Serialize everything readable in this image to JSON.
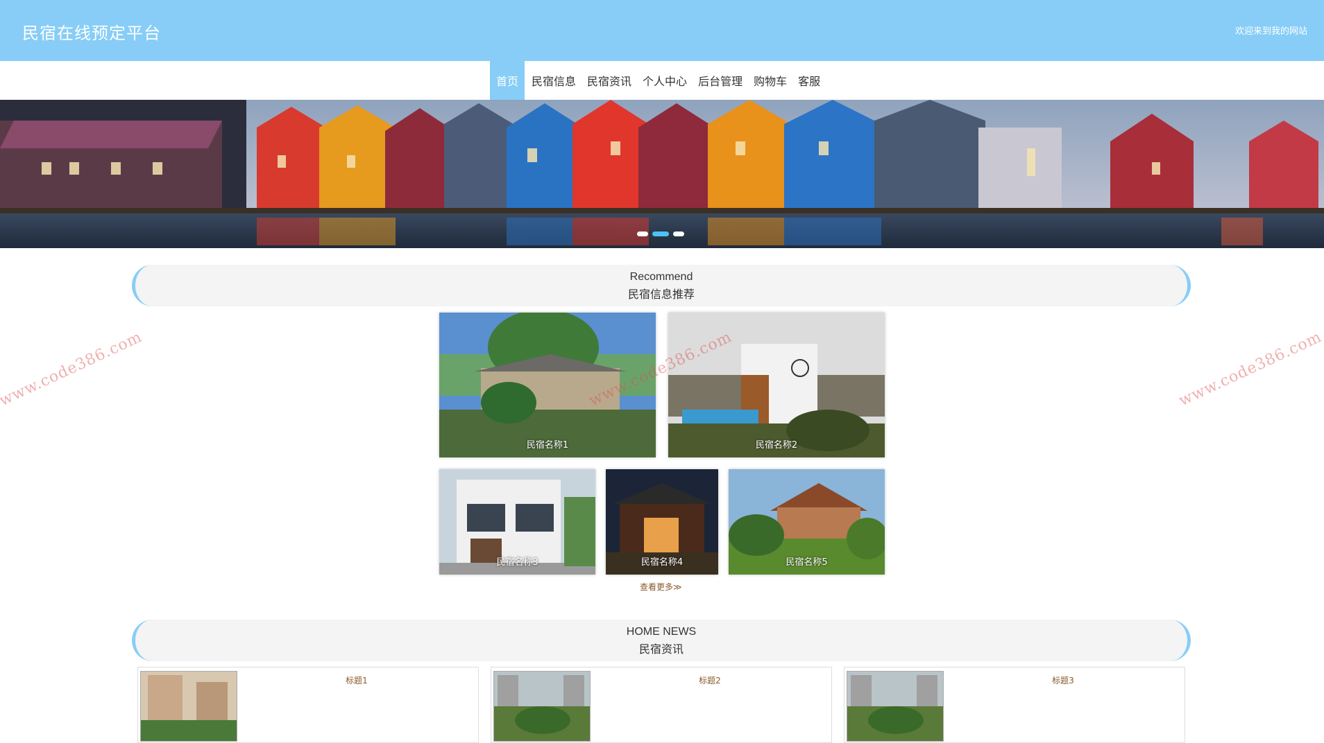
{
  "header": {
    "title": "民宿在线预定平台",
    "welcome": "欢迎来到我的网站"
  },
  "nav": {
    "items": [
      {
        "label": "首页",
        "active": true
      },
      {
        "label": "民宿信息",
        "active": false
      },
      {
        "label": "民宿资讯",
        "active": false
      },
      {
        "label": "个人中心",
        "active": false
      },
      {
        "label": "后台管理",
        "active": false
      },
      {
        "label": "购物车",
        "active": false
      },
      {
        "label": "客服",
        "active": false
      }
    ]
  },
  "banner": {
    "slides": 3,
    "active_slide": 2
  },
  "recommend": {
    "title_en": "Recommend",
    "title_cn": "民宿信息推荐",
    "items": [
      {
        "name": "民宿名称1"
      },
      {
        "name": "民宿名称2"
      },
      {
        "name": "民宿名称3"
      },
      {
        "name": "民宿名称4"
      },
      {
        "name": "民宿名称5"
      }
    ],
    "more": "查看更多≫"
  },
  "news": {
    "title_en": "HOME NEWS",
    "title_cn": "民宿资讯",
    "items": [
      {
        "title": "标题1"
      },
      {
        "title": "标题2"
      },
      {
        "title": "标题3"
      }
    ]
  },
  "watermark": "www.code386.com",
  "colors": {
    "header_bg": "#87cdf7",
    "nav_active": "#87cdf7",
    "dot_active": "#4cc3f4",
    "link": "#8a5a2b"
  }
}
